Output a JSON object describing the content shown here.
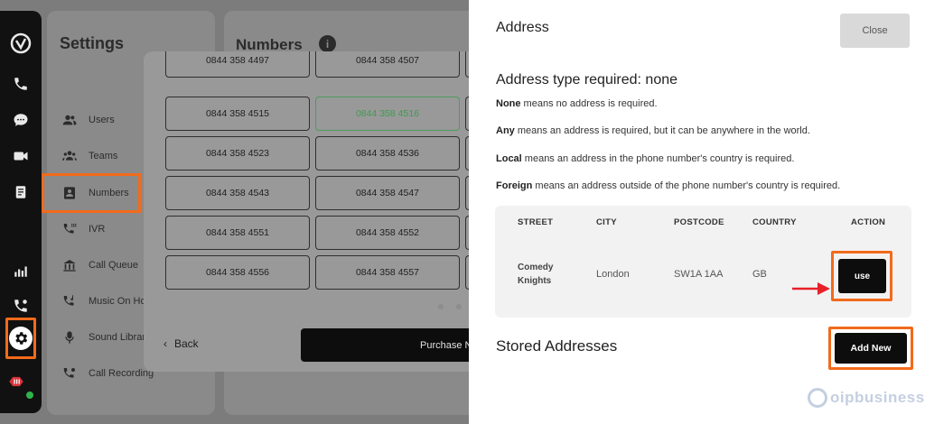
{
  "rail": {
    "icons": [
      "logo-icon",
      "phone-icon",
      "chat-icon",
      "video-icon",
      "notes-icon",
      "analytics-icon",
      "call-settings-icon",
      "gear-icon",
      "avatar"
    ]
  },
  "settings": {
    "title": "Settings",
    "items": [
      {
        "label": "Users",
        "icon": "users-icon"
      },
      {
        "label": "Teams",
        "icon": "teams-icon"
      },
      {
        "label": "Numbers",
        "icon": "numbers-icon"
      },
      {
        "label": "IVR",
        "icon": "ivr-icon"
      },
      {
        "label": "Call Queue",
        "icon": "call-queue-icon"
      },
      {
        "label": "Music On Ho",
        "icon": "music-on-hold-icon"
      },
      {
        "label": "Sound Librar",
        "icon": "sound-library-icon"
      },
      {
        "label": "Call Recording",
        "icon": "call-recording-icon"
      }
    ]
  },
  "numbers": {
    "title": "Numbers",
    "info": "i"
  },
  "modal": {
    "rows": [
      [
        "0844 358 4497",
        "0844 358 4507"
      ],
      [
        "0844 358 4515",
        "0844 358 4516"
      ],
      [
        "0844 358 4523",
        "0844 358 4536"
      ],
      [
        "0844 358 4543",
        "0844 358 4547"
      ],
      [
        "0844 358 4551",
        "0844 358 4552"
      ],
      [
        "0844 358 4556",
        "0844 358 4557"
      ]
    ],
    "selected_number": "0844 358 4516",
    "back_label": "Back",
    "purchase_label": "Purchase N"
  },
  "drawer": {
    "title": "Address",
    "close_label": "Close",
    "required_title": "Address type required: none",
    "descriptions": [
      {
        "term": "None",
        "text": " means no address is required."
      },
      {
        "term": "Any",
        "text": " means an address is required, but it can be anywhere in the world."
      },
      {
        "term": "Local",
        "text": " means an address in the phone number's country is required."
      },
      {
        "term": "Foreign",
        "text": " means an address outside of the phone number's country is required."
      }
    ],
    "table": {
      "headers": [
        "STREET",
        "CITY",
        "POSTCODE",
        "COUNTRY",
        "ACTION"
      ],
      "row": {
        "street_line1": "Comedy",
        "street_line2": "Knights",
        "city": "London",
        "postcode": "SW1A 1AA",
        "country": "GB",
        "action": "use"
      }
    },
    "stored_title": "Stored Addresses",
    "add_new_label": "Add New"
  },
  "watermark": "oipbusiness",
  "colors": {
    "highlight": "#f26a1b",
    "selected_number": "#3f9b4f",
    "arrow": "#e8202a",
    "button": "#0d0d0d"
  }
}
